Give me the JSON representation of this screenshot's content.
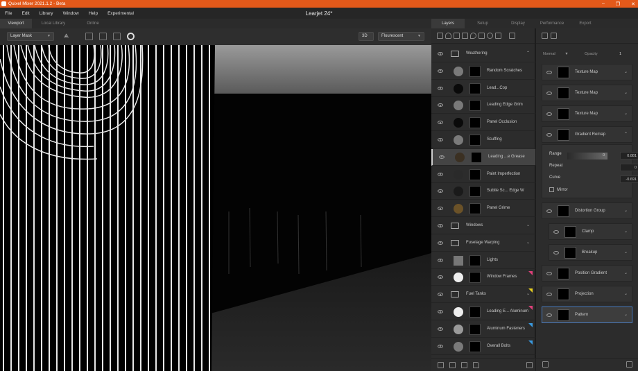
{
  "window": {
    "title": "Quixel Mixer 2021.1.2 - Beta",
    "controls": [
      "–",
      "❐",
      "✕"
    ]
  },
  "menu": [
    "File",
    "Edit",
    "Library",
    "Window",
    "Help",
    "Experimental"
  ],
  "document_title": "Learjet 24*",
  "left_tabs": [
    "Viewport",
    "Local Library",
    "Online"
  ],
  "viewport_toolbar": {
    "mask_mode": "Layer Mask",
    "view_mode": "3D",
    "lighting": "Flourescent"
  },
  "right_tabs": [
    "Layers",
    "Setup",
    "Display",
    "Performance",
    "Export"
  ],
  "layers": [
    {
      "name": "Weathering",
      "kind": "folder",
      "expanded": true
    },
    {
      "name": "Random Scratches",
      "kind": "layer",
      "dot": "#7a7a7a"
    },
    {
      "name": "Lead...Cop",
      "kind": "layer",
      "dot": "#0a0a0a"
    },
    {
      "name": "Leading Edge Grim",
      "kind": "layer",
      "dot": "#7a7a7a"
    },
    {
      "name": "Panel Occlusion",
      "kind": "layer",
      "dot": "#0a0a0a"
    },
    {
      "name": "Scuffing",
      "kind": "layer",
      "dot": "#7a7a7a"
    },
    {
      "name": "Leading ...e Grease",
      "kind": "layer",
      "dot": "#3b3022",
      "selected": true
    },
    {
      "name": "Paint Imperfection",
      "kind": "layer",
      "dot": "#2a2a2a"
    },
    {
      "name": "Subtle Sc... Edge W",
      "kind": "layer",
      "dot": "#1a1a1a"
    },
    {
      "name": "Panel Grime",
      "kind": "layer",
      "dot": "#6b5228"
    },
    {
      "name": "Windows",
      "kind": "folder"
    },
    {
      "name": "Fuselage Warping",
      "kind": "folder"
    },
    {
      "name": "Lights",
      "kind": "layer"
    },
    {
      "name": "Window Frames",
      "kind": "layer",
      "dot": "#eeeeee",
      "tag": "#e0407a"
    },
    {
      "name": "Fuel Tanks",
      "kind": "folder",
      "tag": "#e8d020"
    },
    {
      "name": "Leading E... Aluminum",
      "kind": "layer",
      "dot": "#eeeeee",
      "tag": "#e0407a"
    },
    {
      "name": "Aluminum Fasteners",
      "kind": "layer",
      "dot": "#9a9a9a",
      "tag": "#3a9ae0"
    },
    {
      "name": "Overall Bolts",
      "kind": "layer",
      "dot": "#7a7a7a",
      "tag": "#3a9ae0"
    }
  ],
  "blend": {
    "mode": "Normal",
    "opacity_label": "Opacity",
    "opacity_value": "1"
  },
  "mask_stack": [
    {
      "name": "Texture Map"
    },
    {
      "name": "Texture Map"
    },
    {
      "name": "Texture Map"
    },
    {
      "name": "Gradient Remap",
      "expanded": true
    },
    {
      "name": "Distortion Group"
    },
    {
      "name": "Clamp"
    },
    {
      "name": "Breakup"
    },
    {
      "name": "Position Gradient"
    },
    {
      "name": "Projection"
    },
    {
      "name": "Pattern",
      "selected": true
    }
  ],
  "gradient_remap": {
    "range_label": "Range",
    "range_min": "0",
    "range_max": "0.881",
    "repeat_label": "Repeat",
    "repeat_value": "0",
    "curve_label": "Curve",
    "curve_value": "-0.691",
    "mirror_label": "Mirror"
  }
}
